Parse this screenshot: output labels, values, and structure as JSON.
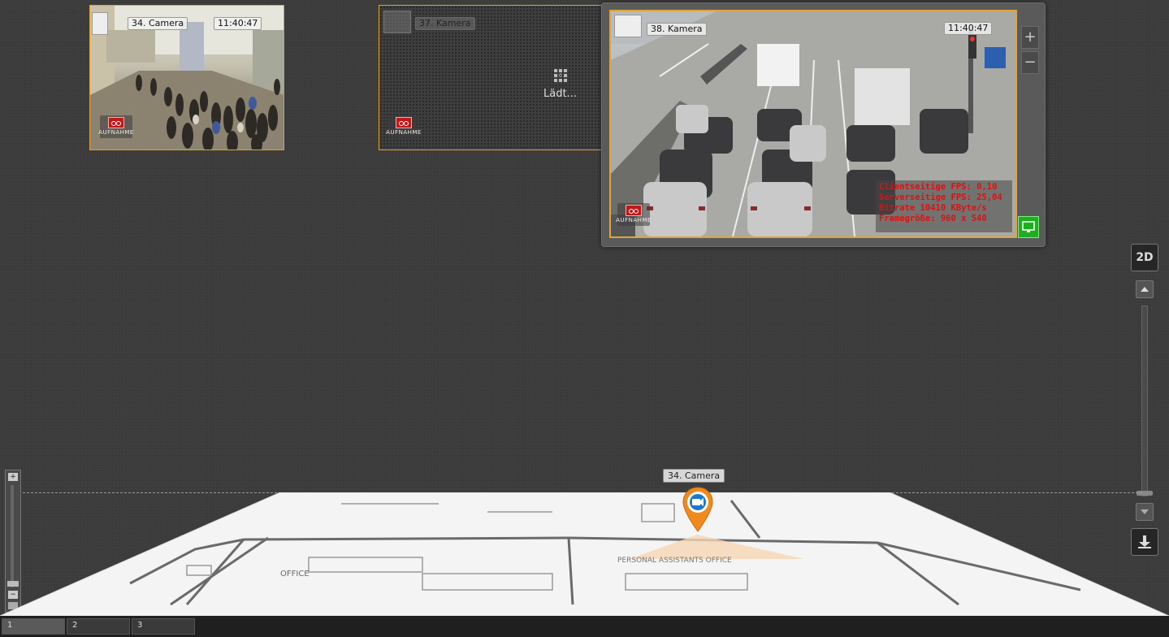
{
  "cameras": {
    "cam34": {
      "label": "34. Camera",
      "time": "11:40:47",
      "record_label": "AUFNAHME",
      "icon": "camera-settings-icon"
    },
    "cam37": {
      "label": "37. Kamera",
      "status": "Lädt...",
      "record_label": "AUFNAHME",
      "icon": "loading-icon"
    },
    "cam38": {
      "label": "38. Kamera",
      "time": "11:40:47",
      "record_label": "AUFNAHME",
      "stats": {
        "client_fps": "Clientseitige FPS: 0,10",
        "server_fps": "Serverseitige FPS: 25,04",
        "bitrate": "Bitrate 10410 KByte/s",
        "frame_size": "Framegröße: 960 x 540"
      },
      "icon": "camera-settings-icon",
      "monitor_icon": "monitor-icon"
    }
  },
  "zoom": {
    "plus": "+",
    "minus": "−"
  },
  "view_mode_button": "2D",
  "map": {
    "camera_marker_label": "34. Camera",
    "room_labels": [
      "OFFICE",
      "PERSONAL ASSISTANTS OFFICE"
    ]
  },
  "left_scale": {
    "plus": "+",
    "minus": "−"
  },
  "tabs": [
    {
      "label": "1",
      "active": true
    },
    {
      "label": "2",
      "active": false
    },
    {
      "label": "3",
      "active": false
    }
  ],
  "colors": {
    "tile_border": "#d9a23a",
    "record": "#c21818",
    "stats_text": "#e01010",
    "monitor": "#1fae1f",
    "marker": "#f08a1c"
  }
}
